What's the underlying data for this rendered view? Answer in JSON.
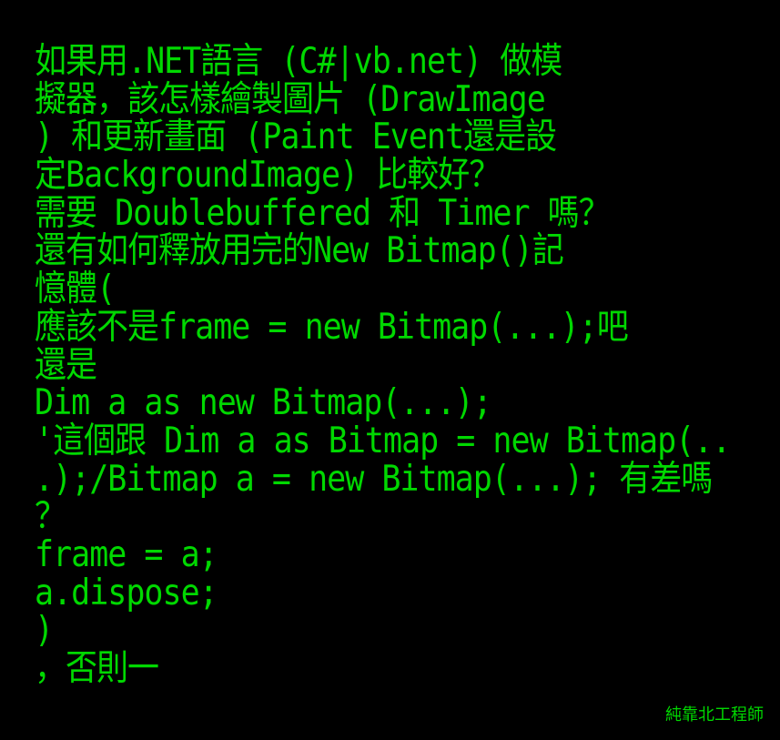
{
  "colors": {
    "background": "#000000",
    "text": "#00d800"
  },
  "lines": [
    "如果用.NET語言 (C#|vb.net) 做模",
    "擬器，該怎樣繪製圖片 (DrawImage",
    ") 和更新畫面 (Paint Event還是設",
    "定BackgroundImage) 比較好？",
    "需要 Doublebuffered 和 Timer 嗎？",
    "還有如何釋放用完的New Bitmap()記",
    "憶體(",
    "應該不是frame = new Bitmap(...);吧",
    "還是",
    "Dim a as new Bitmap(...);",
    "'這個跟 Dim a as Bitmap = new Bitmap(..",
    ".);/Bitmap a = new Bitmap(...); 有差嗎",
    "？",
    "frame = a;",
    "a.dispose;",
    ")",
    "，否則一"
  ],
  "signature": "純靠北工程師"
}
